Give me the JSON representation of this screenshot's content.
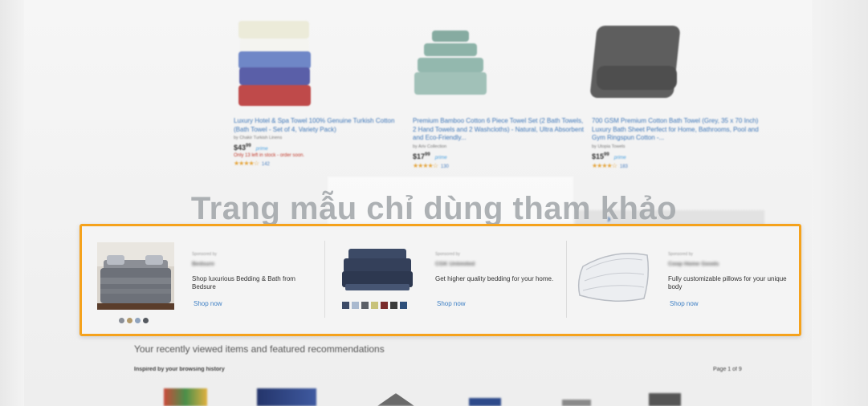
{
  "watermark": "Trang mẫu chỉ dùng tham khảo",
  "products": [
    {
      "title": "Luxury Hotel & Spa Towel 100% Genuine Turkish Cotton (Bath Towel - Set of 4, Variety Pack)",
      "by": "by Chakir Turkish Linens",
      "price_main": "$43",
      "price_cents": "99",
      "prime": "prime",
      "stock": "Only 13 left in stock - order soon.",
      "stars": "★★★★☆",
      "count": "142"
    },
    {
      "title": "Premium Bamboo Cotton 6 Piece Towel Set (2 Bath Towels, 2 Hand Towels and 2 Washcloths) - Natural, Ultra Absorbent and Eco-Friendly...",
      "by": "by Ariv Collection",
      "price_main": "$17",
      "price_cents": "99",
      "prime": "prime",
      "stock": "",
      "stars": "★★★★☆",
      "count": "130"
    },
    {
      "title": "700 GSM Premium Cotton Bath Towel (Grey, 35 x 70 Inch) Luxury Bath Sheet Perfect for Home, Bathrooms, Pool and Gym Ringspun Cotton -...",
      "by": "by Utopia Towels",
      "price_main": "$15",
      "price_cents": "99",
      "prime": "prime",
      "stock": "",
      "stars": "★★★★☆",
      "count": "183"
    }
  ],
  "banner": {
    "ads": [
      {
        "sponsored": "Sponsored by",
        "brand": "Bedsure",
        "desc": "Shop luxurious Bedding & Bath from Bedsure",
        "shop": "Shop now"
      },
      {
        "sponsored": "Sponsored by",
        "brand": "CGK Unlimited",
        "desc": "Get higher quality bedding for your home.",
        "shop": "Shop now"
      },
      {
        "sponsored": "Sponsored by",
        "brand": "Coop Home Goods",
        "desc": "Fully customizable pillows for your unique body",
        "shop": "Shop now"
      }
    ],
    "dot_colors": [
      "#8a8f97",
      "#b29a6c",
      "#8fa3bd",
      "#55595f"
    ],
    "swatch_colors": [
      "#3c4a66",
      "#a9b9cf",
      "#5b5f66",
      "#c8c27a",
      "#7a2c2c",
      "#3b3b3b",
      "#2d4f7a"
    ]
  },
  "recommendations": {
    "title": "Your recently viewed items and featured recommendations",
    "subtitle": "Inspired by your browsing history",
    "page": "Page 1 of 9"
  },
  "colors": {
    "accent_border": "#f5a21c",
    "link": "#3d76b8"
  }
}
